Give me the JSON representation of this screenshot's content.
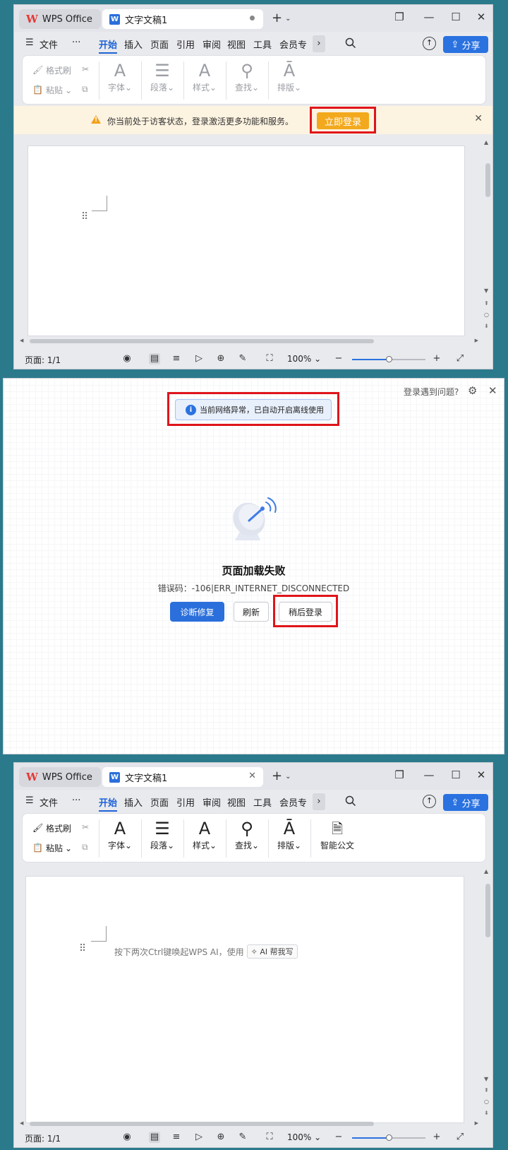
{
  "app": {
    "wps_tab_label": "WPS Office",
    "doc_tab_label": "文字文稿1",
    "new_tab_glyph": "+"
  },
  "menu": {
    "file": "文件",
    "more": "···",
    "tabs": [
      "开始",
      "插入",
      "页面",
      "引用",
      "审阅",
      "视图",
      "工具",
      "会员专"
    ],
    "share": "分享"
  },
  "ribbon": {
    "format_painter": "格式刷",
    "paste": "粘贴",
    "font": "字体",
    "paragraph": "段落",
    "style": "样式",
    "find": "查找",
    "layout": "排版",
    "smart_doc": "智能公文"
  },
  "banner": {
    "message": "你当前处于访客状态，登录激活更多功能和服务。",
    "login_button": "立即登录"
  },
  "status": {
    "page_info": "页面: 1/1",
    "zoom": "100%",
    "zoom_level_percent": 50
  },
  "dialog": {
    "help_link": "登录遇到问题?",
    "network_notice": "当前网络异常，已自动开启离线使用",
    "fail_title": "页面加载失败",
    "error_code": "错误码：-106|ERR_INTERNET_DISCONNECTED",
    "diagnose_button": "诊断修复",
    "refresh_button": "刷新",
    "later_login_button": "稍后登录"
  },
  "ai": {
    "hint": "按下两次Ctrl键唤起WPS AI，使用",
    "chip": "AI 帮我写"
  },
  "colors": {
    "accent": "#2a72e0",
    "highlight_box": "#e0141b",
    "login_orange": "#f3a91d"
  }
}
